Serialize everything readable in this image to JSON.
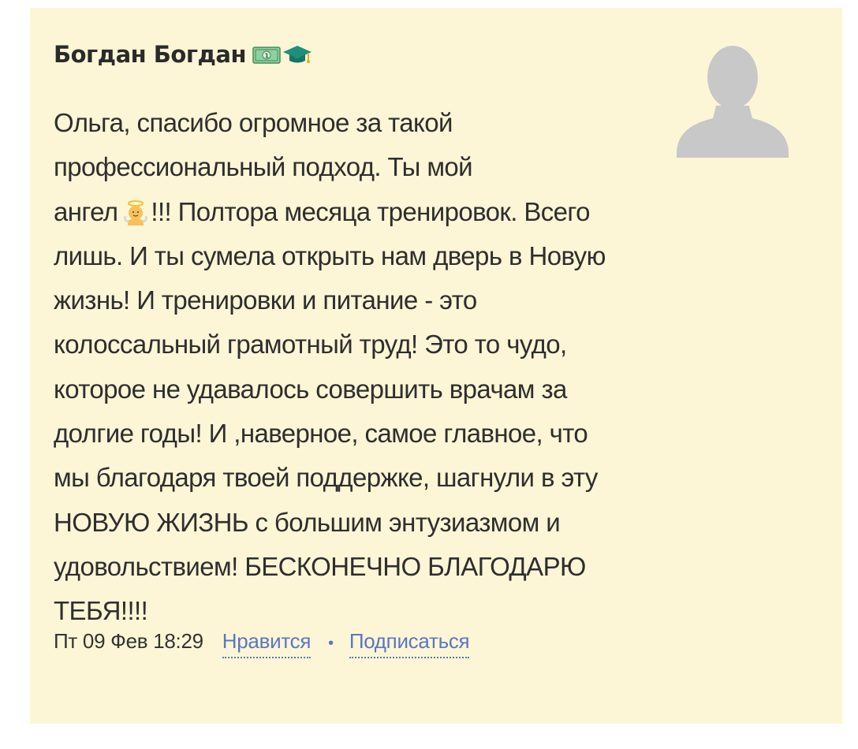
{
  "comment": {
    "author": "Богдан Богдан",
    "author_badges": [
      "money-banknote-icon",
      "graduation-cap-icon"
    ],
    "message_lines": [
      "Ольга, спасибо огромное за такой",
      "профессиональный подход. Ты мой",
      "ангел",
      "!!! Полтора месяца тренировок. Всего",
      "лишь. И ты сумела открыть нам дверь в Новую",
      "жизнь! И тренировки и питание - это",
      "колоссальный грамотный труд! Это то чудо,",
      "которое не удавалось совершить врачам за",
      "долгие годы! И ,наверное, самое главное, что",
      "мы благодаря твоей поддержке, шагнули в эту",
      "НОВУЮ ЖИЗНЬ с большим энтузиазмом и",
      "удовольствием! БЕСКОНЕЧНО БЛАГОДАРЮ",
      "ТЕБЯ!!!!"
    ],
    "inline_emoji": "angel-baby-icon",
    "date": "Пт 09 Фев 18:29",
    "like_label": "Нравится",
    "separator": "•",
    "subscribe_label": "Подписаться"
  },
  "colors": {
    "card_background": "#fdf6d6",
    "link": "#5a76c4",
    "avatar_placeholder": "#c8c8c8"
  }
}
